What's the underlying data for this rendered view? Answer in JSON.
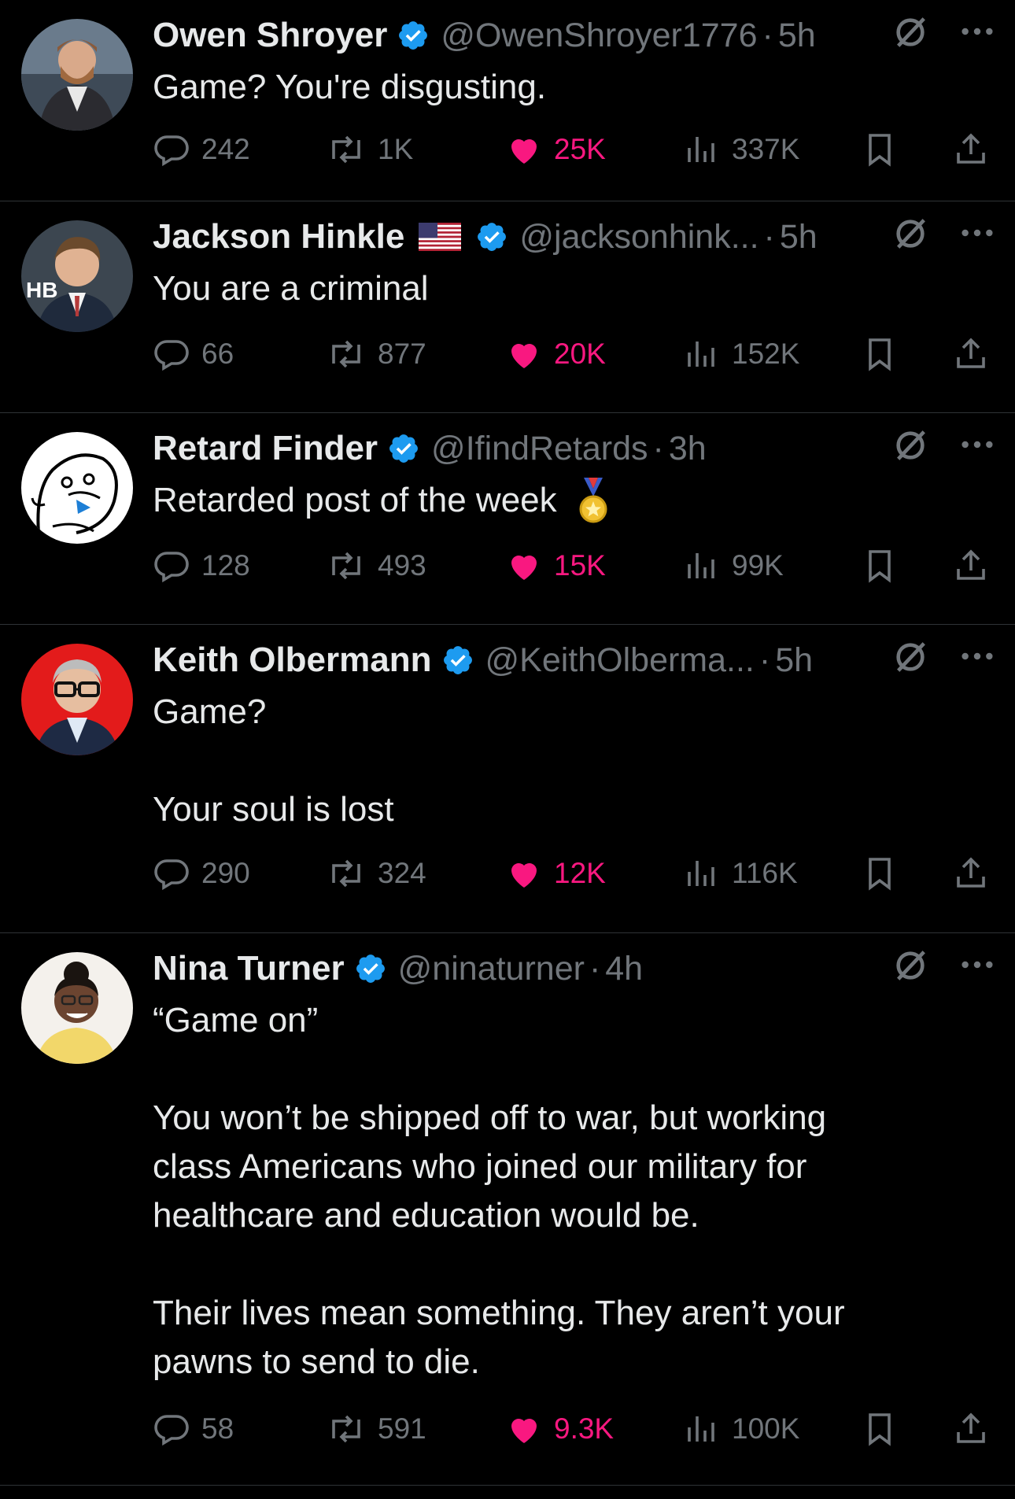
{
  "colors": {
    "background": "#000000",
    "text": "#e7e9ea",
    "secondary": "#71767b",
    "like": "#f91880",
    "verified": "#1d9bf0",
    "divider": "#2f3336"
  },
  "replies": [
    {
      "name": "Owen Shroyer",
      "handle": "@OwenShroyer1776",
      "time": "5h",
      "text": [
        "Game? You're disgusting."
      ],
      "replies": "242",
      "reposts": "1K",
      "likes": "25K",
      "views": "337K"
    },
    {
      "name": "Jackson Hinkle",
      "handle": "@jacksonhink...",
      "time": "5h",
      "text": [
        "You are a criminal"
      ],
      "replies": "66",
      "reposts": "877",
      "likes": "20K",
      "views": "152K"
    },
    {
      "name": "Retard Finder",
      "handle": "@IfindRetards",
      "time": "3h",
      "text": [
        "Retarded post of the week"
      ],
      "replies": "128",
      "reposts": "493",
      "likes": "15K",
      "views": "99K"
    },
    {
      "name": "Keith Olbermann",
      "handle": "@KeithOlberma...",
      "time": "5h",
      "text": [
        "Game?",
        "",
        "Your soul is lost"
      ],
      "replies": "290",
      "reposts": "324",
      "likes": "12K",
      "views": "116K"
    },
    {
      "name": "Nina Turner",
      "handle": "@ninaturner",
      "time": "4h",
      "text": [
        "“Game on”",
        "",
        "You won’t be shipped off to war, but working",
        "class Americans who joined our military for",
        "healthcare and education would be.",
        "",
        "Their lives mean something. They aren’t your",
        "pawns to send to die."
      ],
      "replies": "58",
      "reposts": "591",
      "likes": "9.3K",
      "views": "100K"
    }
  ],
  "icons": [
    "verified-badge-icon",
    "us-flag-icon",
    "gold-medal-icon",
    "grok-icon",
    "more-icon",
    "reply-icon",
    "repost-icon",
    "like-icon",
    "views-icon",
    "bookmark-icon",
    "share-icon"
  ]
}
